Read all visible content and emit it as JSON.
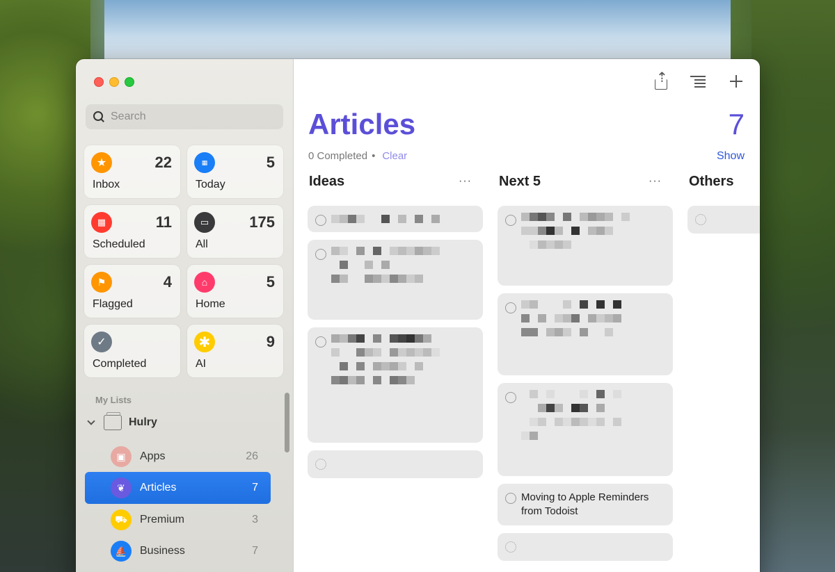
{
  "sidebar": {
    "search_placeholder": "Search",
    "smart_lists": [
      {
        "label": "Inbox",
        "count": "22",
        "icon": "star-icon",
        "color": "#ff9500"
      },
      {
        "label": "Today",
        "count": "5",
        "icon": "calendar-icon",
        "color": "#1a7ef7"
      },
      {
        "label": "Scheduled",
        "count": "11",
        "icon": "scheduled-calendar-icon",
        "color": "#ff3b30"
      },
      {
        "label": "All",
        "count": "175",
        "icon": "tray-icon",
        "color": "#3a3a3c"
      },
      {
        "label": "Flagged",
        "count": "4",
        "icon": "flag-icon",
        "color": "#ff9500"
      },
      {
        "label": "Home",
        "count": "5",
        "icon": "house-icon",
        "color": "#ff3b6b"
      },
      {
        "label": "Completed",
        "count": "",
        "icon": "checkmark-icon",
        "color": "#6e7a85"
      },
      {
        "label": "AI",
        "count": "9",
        "icon": "asterisk-icon",
        "color": "#ffcc00"
      }
    ],
    "section_label": "My Lists",
    "group_name": "Hulry",
    "lists": [
      {
        "name": "Apps",
        "count": "26",
        "icon": "app-icon",
        "color": "#e8a9a3"
      },
      {
        "name": "Articles",
        "count": "7",
        "icon": "leaf-icon",
        "color": "#6a5ae0"
      },
      {
        "name": "Premium",
        "count": "3",
        "icon": "cart-icon",
        "color": "#ffcc00"
      },
      {
        "name": "Business",
        "count": "7",
        "icon": "sailboat-icon",
        "color": "#1a7ef7"
      }
    ]
  },
  "main": {
    "title": "Articles",
    "count": "7",
    "completed_text": "0 Completed",
    "clear_label": "Clear",
    "show_label": "Show",
    "columns": [
      {
        "name": "Ideas"
      },
      {
        "name": "Next 5",
        "visible_task": "Moving to Apple Reminders from Todoist"
      },
      {
        "name": "Others"
      }
    ]
  },
  "colors": {
    "accent": "#5b4fd8",
    "selection": "#1f6fe0"
  }
}
